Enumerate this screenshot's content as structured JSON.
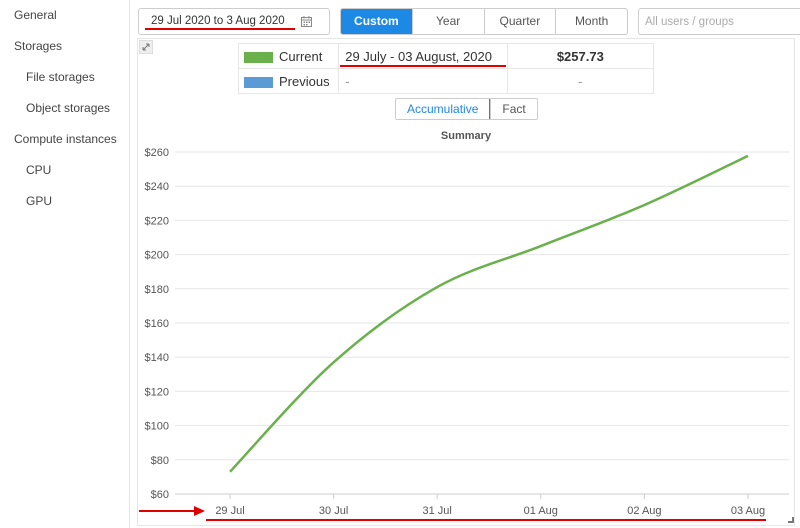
{
  "sidebar": {
    "items": [
      {
        "label": "General",
        "active": true,
        "level": 0
      },
      {
        "label": "Storages",
        "active": false,
        "level": 0
      },
      {
        "label": "File storages",
        "active": false,
        "level": 1
      },
      {
        "label": "Object storages",
        "active": false,
        "level": 1
      },
      {
        "label": "Compute instances",
        "active": false,
        "level": 0
      },
      {
        "label": "CPU",
        "active": false,
        "level": 1
      },
      {
        "label": "GPU",
        "active": false,
        "level": 1
      }
    ]
  },
  "toolbar": {
    "date_range": "29 Jul 2020 to 3 Aug 2020",
    "date_icon": "calendar-icon",
    "periods": [
      {
        "label": "Custom",
        "active": true
      },
      {
        "label": "Year",
        "active": false
      },
      {
        "label": "Quarter",
        "active": false
      },
      {
        "label": "Month",
        "active": false
      }
    ],
    "users_placeholder": "All users / groups"
  },
  "legend": {
    "rows": [
      {
        "name": "Current",
        "color": "#6ab04c",
        "range": "29 July - 03 August, 2020",
        "cost": "$257.73"
      },
      {
        "name": "Previous",
        "color": "#5b9bd5",
        "range": "-",
        "cost": "-"
      }
    ]
  },
  "mode_toggle": {
    "options": [
      {
        "label": "Accumulative",
        "active": true
      },
      {
        "label": "Fact",
        "active": false
      }
    ]
  },
  "chart_data": {
    "type": "line",
    "title": "Summary",
    "xlabel": "",
    "ylabel": "",
    "categories": [
      "29 Jul",
      "30 Jul",
      "31 Jul",
      "01 Aug",
      "02 Aug",
      "03 Aug"
    ],
    "series": [
      {
        "name": "Current",
        "color": "#6ab04c",
        "values": [
          73,
          137,
          181,
          205,
          229,
          257.73
        ]
      }
    ],
    "yticks": [
      "$60",
      "$80",
      "$100",
      "$120",
      "$140",
      "$160",
      "$180",
      "$200",
      "$220",
      "$240",
      "$260"
    ],
    "ylim": [
      60,
      260
    ],
    "grid": true,
    "legend": "none"
  },
  "colors": {
    "accent": "#1e88e5",
    "annotation": "#e00000"
  }
}
